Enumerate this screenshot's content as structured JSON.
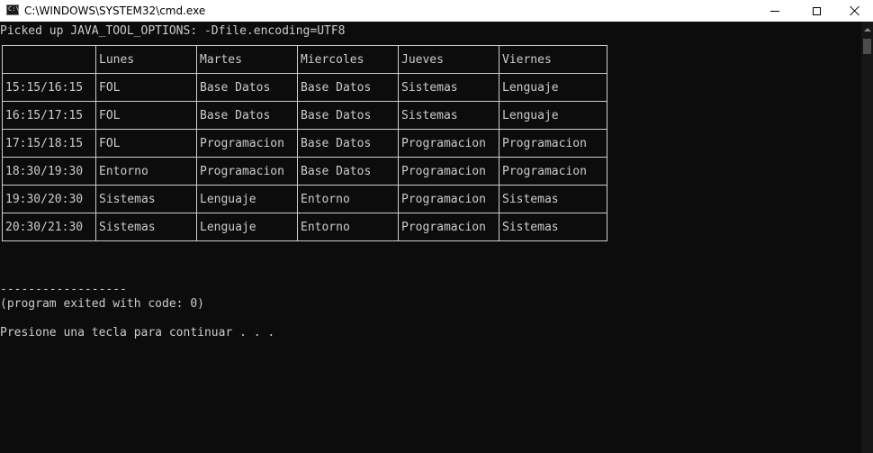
{
  "window": {
    "title": "C:\\WINDOWS\\SYSTEM32\\cmd.exe",
    "icon": "cmd-icon",
    "prompt_glyph": "C:\\",
    "controls": [
      "minimize-icon",
      "maximize-icon",
      "close-icon"
    ]
  },
  "console": {
    "java_options_line": "Picked up JAVA_TOOL_OPTIONS: -Dfile.encoding=UTF8",
    "dashes_line": "------------------",
    "exit_line": "(program exited with code: 0)",
    "press_key_line": "Presione una tecla para continuar . . ."
  },
  "schedule": {
    "headers": [
      "",
      "Lunes",
      "Martes",
      "Miercoles",
      "Jueves",
      "Viernes"
    ],
    "rows": [
      [
        "15:15/16:15",
        "FOL",
        "Base Datos",
        "Base Datos",
        "Sistemas",
        "Lenguaje"
      ],
      [
        "16:15/17:15",
        "FOL",
        "Base Datos",
        "Base Datos",
        "Sistemas",
        "Lenguaje"
      ],
      [
        "17:15/18:15",
        "FOL",
        "Programacion",
        "Base Datos",
        "Programacion",
        "Programacion"
      ],
      [
        "18:30/19:30",
        "Entorno",
        "Programacion",
        "Base Datos",
        "Programacion",
        "Programacion"
      ],
      [
        "19:30/20:30",
        "Sistemas",
        "Lenguaje",
        "Entorno",
        "Programacion",
        "Sistemas"
      ],
      [
        "20:30/21:30",
        "Sistemas",
        "Lenguaje",
        "Entorno",
        "Programacion",
        "Sistemas"
      ]
    ]
  },
  "colors": {
    "console_background": "#0c0c0c",
    "console_text": "#cccccc",
    "titlebar_background": "#ffffff"
  }
}
